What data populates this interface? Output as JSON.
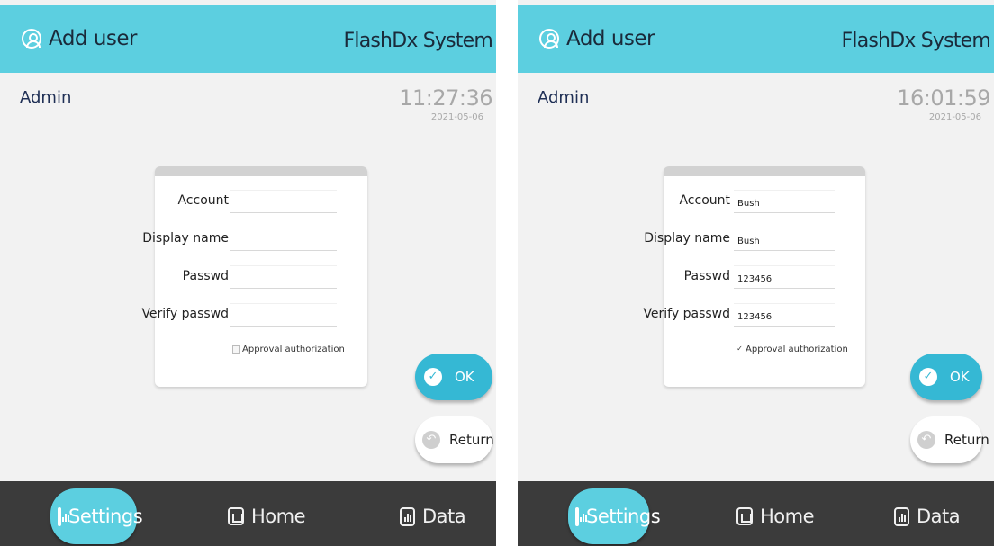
{
  "screens": [
    {
      "header": {
        "title": "Add user",
        "brand": "FlashDx System"
      },
      "user": "Admin",
      "clock": {
        "time": "11:27:36",
        "date": "2021-05-06"
      },
      "form": {
        "account_label": "Account",
        "account_value": "",
        "display_label": "Display name",
        "display_value": "",
        "passwd_label": "Passwd",
        "passwd_value": "",
        "verify_label": "Verify passwd",
        "verify_value": "",
        "approval_label": "Approval authorization",
        "approval_checked": false
      },
      "buttons": {
        "ok": "OK",
        "return": "Return"
      },
      "nav": {
        "settings": "Settings",
        "home": "Home",
        "data": "Data",
        "active": "settings"
      }
    },
    {
      "header": {
        "title": "Add user",
        "brand": "FlashDx System"
      },
      "user": "Admin",
      "clock": {
        "time": "16:01:59",
        "date": "2021-05-06"
      },
      "form": {
        "account_label": "Account",
        "account_value": "Bush",
        "display_label": "Display name",
        "display_value": "Bush",
        "passwd_label": "Passwd",
        "passwd_value": "123456",
        "verify_label": "Verify passwd",
        "verify_value": "123456",
        "approval_label": "Approval authorization",
        "approval_checked": true
      },
      "buttons": {
        "ok": "OK",
        "return": "Return"
      },
      "nav": {
        "settings": "Settings",
        "home": "Home",
        "data": "Data",
        "active": "settings"
      }
    }
  ],
  "colors": {
    "accent": "#5ccfe0",
    "button": "#35b8d4",
    "nav_bg": "#3b3b3b",
    "page_bg": "#f2f2f2"
  },
  "icons": {
    "header": "user-circle-icon",
    "ok": "check-icon",
    "return": "return-icon",
    "settings": "chart-icon",
    "home": "home-icon",
    "data": "chart-icon"
  }
}
